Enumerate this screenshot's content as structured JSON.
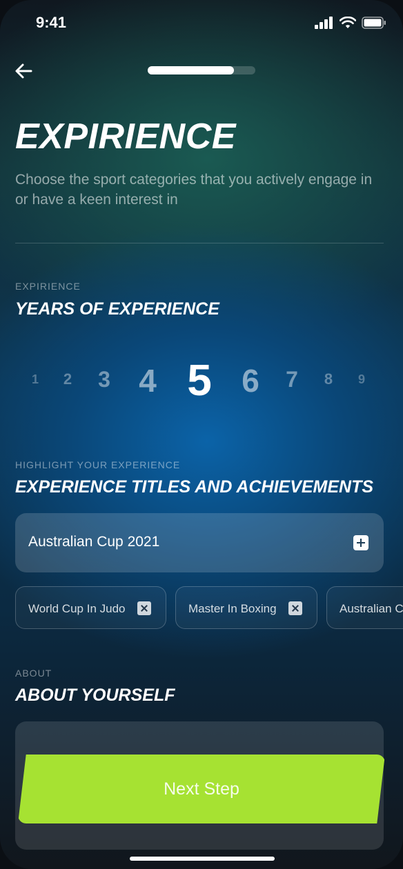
{
  "status_bar": {
    "time": "9:41"
  },
  "progress": {
    "value": 0.8
  },
  "header": {
    "title": "EXPIRIENCE",
    "subtitle": "Choose the sport categories that you actively engage in or have a keen interest in"
  },
  "experience": {
    "eyebrow": "EXPIRIENCE",
    "title": "YEARS OF EXPERIENCE",
    "years": [
      "1",
      "2",
      "3",
      "4",
      "5",
      "6",
      "7",
      "8",
      "9"
    ],
    "selected": "5"
  },
  "achievements": {
    "eyebrow": "HIGHLIGHT YOUR EXPERIENCE",
    "title": "EXPERIENCE TITLES AND ACHIEVEMENTS",
    "input_value": "Australian Cup 2021",
    "chips": [
      "World Cup In Judo",
      "Master In Boxing",
      "Australian C"
    ]
  },
  "about": {
    "eyebrow": "ABOUT",
    "title": "ABOUT YOURSELF"
  },
  "cta": {
    "label": "Next Step",
    "color": "#a6e232"
  }
}
